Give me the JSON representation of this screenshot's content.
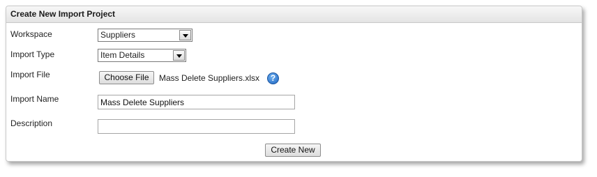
{
  "panel": {
    "title": "Create New Import Project"
  },
  "form": {
    "workspace": {
      "label": "Workspace",
      "selected": "Suppliers"
    },
    "import_type": {
      "label": "Import Type",
      "selected": "Item Details"
    },
    "import_file": {
      "label": "Import File",
      "choose_button": "Choose File",
      "file_name": "Mass Delete Suppliers.xlsx",
      "help_icon": "help-icon",
      "help_glyph": "?"
    },
    "import_name": {
      "label": "Import Name",
      "value": "Mass Delete Suppliers",
      "placeholder": ""
    },
    "description": {
      "label": "Description",
      "value": "",
      "placeholder": ""
    },
    "submit_label": "Create New"
  },
  "colors": {
    "help_icon": "#1f66c2",
    "header_bg": "#e4e4e4"
  }
}
